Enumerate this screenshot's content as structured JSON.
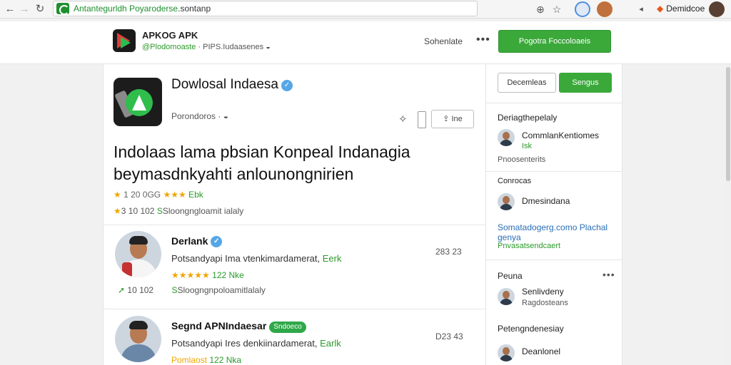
{
  "browser": {
    "url_host": "Antantegurldh Poyaroderse",
    "url_path": "sontanp",
    "profile_name": "Demidcoe"
  },
  "site": {
    "name": "APKOG APK",
    "tagline_prefix": "@Plodomoaste",
    "tagline_rest": "PIPS.Iudaasenes",
    "header_link": "Sohenlate",
    "cta_label": "Pogotra Foccoloaeis"
  },
  "app": {
    "title": "Dowlosal Indaesa",
    "subtitle": "Porondoros ·",
    "share_label": "Ine",
    "headline": "Indolaas lama pbsian Konpeal Indanagia beymasdnkyahti anlounongnirien",
    "rating_left": "1 20 0GG",
    "rating_right": "Ebk",
    "stat_count": "10 102",
    "stat_text": "Sloongngloamit ialaly"
  },
  "reviews": [
    {
      "name": "Derlank",
      "text": "Potsandyapi Ima vtenkimardamerat,",
      "text_link": "Eerk",
      "rating": "122 Nke",
      "time": "283 23",
      "stats_count": "10 102",
      "stats_text": "Sloogngnpoloamitlalaly"
    },
    {
      "name": "Segnd APNIndaesar",
      "badge": "Sndoeco",
      "text": "Potsandyapi Ires denkiinardamerat,",
      "text_link": "Earlk",
      "rating_label": "Pomlaost",
      "rating": "122 Nka",
      "time": "D23 43"
    }
  ],
  "sidebar": {
    "btn_outline": "Decemleas",
    "btn_green": "Sengus",
    "section1": {
      "heading": "Deriagthepelaly",
      "user_name": "CommlanKentiomes",
      "user_tag": "Isk",
      "footer": "Pnoosenterits"
    },
    "section2": {
      "heading": "Conrocas",
      "user_name": "Dmesindana",
      "link": "Somatadogerg.como Plachal genya",
      "link2": "Pnvasatsendcaert"
    },
    "section3": {
      "heading": "Peuna",
      "user_name": "Senlivdeny",
      "user_sub": "Ragdosteans",
      "subheading": "Petengndenesiay",
      "user2_name": "Deanlonel"
    }
  },
  "colors": {
    "accent_green": "#3aa93a",
    "link_blue": "#2a6fb5",
    "star": "#f0a500"
  }
}
